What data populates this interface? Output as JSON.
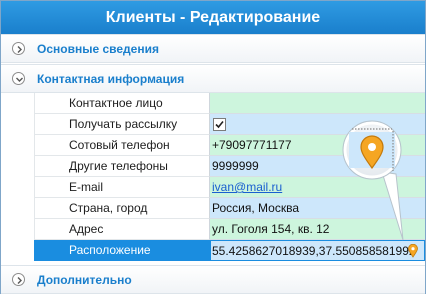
{
  "window": {
    "title": "Клиенты - Редактирование"
  },
  "sections": {
    "basic": "Основные сведения",
    "contact": "Контактная информация",
    "extra": "Дополнительно"
  },
  "fields": [
    {
      "label": "Контактное лицо",
      "value": "",
      "type": "text",
      "color": "green"
    },
    {
      "label": "Получать рассылку",
      "value": "",
      "type": "checkbox",
      "checked": true,
      "color": "blue"
    },
    {
      "label": "Сотовый телефон",
      "value": "+79097771177",
      "type": "text",
      "color": "green"
    },
    {
      "label": "Другие телефоны",
      "value": "9999999",
      "type": "text",
      "color": "blue"
    },
    {
      "label": "E-mail",
      "value": "ivan@mail.ru",
      "type": "link",
      "color": "green"
    },
    {
      "label": "Страна, город",
      "value": "Россия, Москва",
      "type": "text",
      "color": "blue"
    },
    {
      "label": "Адрес",
      "value": "ул. Гоголя 154, кв. 12",
      "type": "text",
      "color": "green"
    },
    {
      "label": "Расположение",
      "value": "55.4258627018939,37.550858581992",
      "type": "location",
      "color": "blue",
      "selected": true
    }
  ],
  "icons": {
    "expand": "chevron-right-icon",
    "collapse": "chevron-down-icon",
    "pin": "map-pin-icon"
  },
  "colors": {
    "title_bar": "#1a8de0",
    "section_text": "#1a7fcc",
    "selected_row": "#1a8de0",
    "value_green": "#cdf5dd",
    "value_blue": "#cde7fb",
    "pin": "#f5a623"
  }
}
